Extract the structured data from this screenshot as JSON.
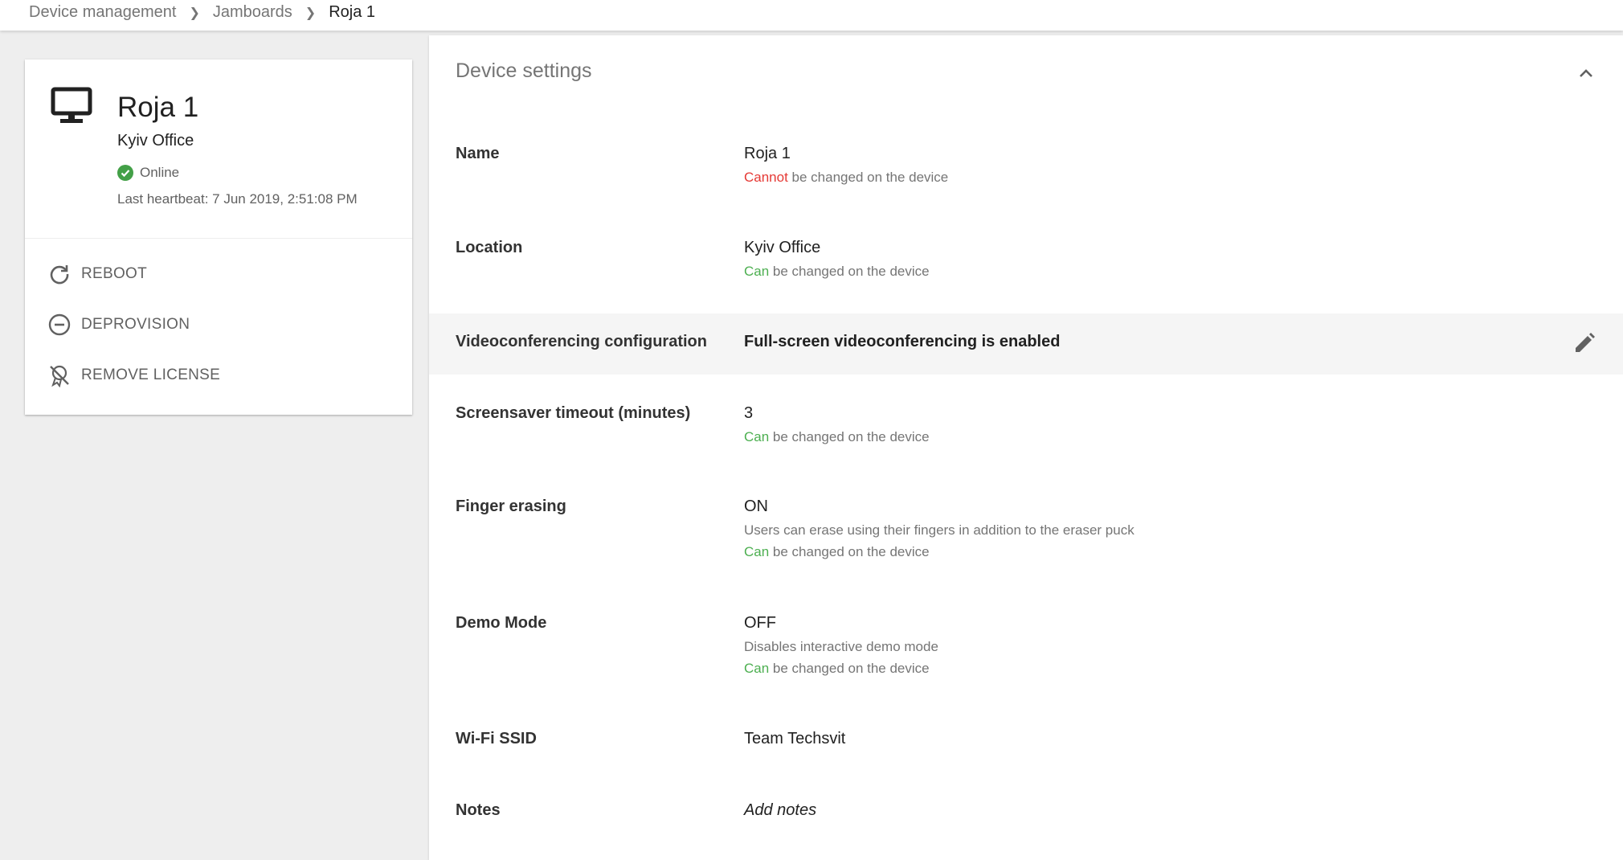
{
  "breadcrumb": {
    "items": [
      "Device management",
      "Jamboards"
    ],
    "current": "Roja 1"
  },
  "device": {
    "name": "Roja 1",
    "location": "Kyiv Office",
    "status": "Online",
    "heartbeat": "Last heartbeat: 7 Jun 2019, 2:51:08 PM",
    "icons": {
      "device": "monitor-icon",
      "status": "check-circle-icon"
    },
    "status_color": "#43a047"
  },
  "actions": [
    {
      "label": "REBOOT",
      "icon": "refresh-icon"
    },
    {
      "label": "DEPROVISION",
      "icon": "minus-circle-icon"
    },
    {
      "label": "REMOVE LICENSE",
      "icon": "no-license-icon"
    }
  ],
  "settings": {
    "title": "Device settings",
    "collapse_icon": "chevron-up-icon",
    "rows": {
      "name": {
        "label": "Name",
        "value": "Roja 1",
        "note_prefix": "Cannot",
        "note_rest": " be changed on the device"
      },
      "location": {
        "label": "Location",
        "value": "Kyiv Office",
        "note_prefix": "Can",
        "note_rest": " be changed on the device"
      },
      "video": {
        "label": "Videoconferencing configuration",
        "value": "Full-screen videoconferencing is enabled",
        "edit_icon": "pencil-icon"
      },
      "screensaver": {
        "label": "Screensaver timeout (minutes)",
        "value": "3",
        "note_prefix": "Can",
        "note_rest": " be changed on the device"
      },
      "finger": {
        "label": "Finger erasing",
        "value": "ON",
        "desc": "Users can erase using their fingers in addition to the eraser puck",
        "note_prefix": "Can",
        "note_rest": " be changed on the device"
      },
      "demo": {
        "label": "Demo Mode",
        "value": "OFF",
        "desc": "Disables interactive demo mode",
        "note_prefix": "Can",
        "note_rest": " be changed on the device"
      },
      "wifi": {
        "label": "Wi-Fi SSID",
        "value": "Team Techsvit"
      },
      "notes": {
        "label": "Notes",
        "value": "Add notes"
      }
    }
  },
  "colors": {
    "can": "#4caf50",
    "cannot": "#e53935",
    "accent": "#757575"
  }
}
